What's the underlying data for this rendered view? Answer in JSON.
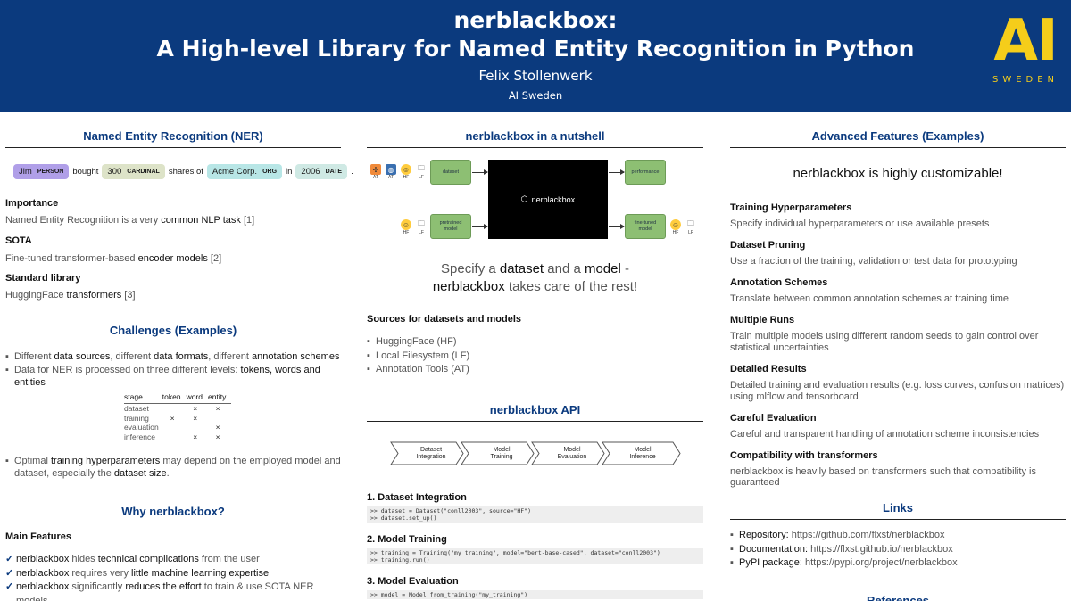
{
  "header": {
    "title_line1": "nerblackbox:",
    "title_line2": "A High-level Library for Named Entity Recognition in Python",
    "author": "Felix Stollenwerk",
    "affiliation": "AI Sweden",
    "logo_text": "AI",
    "logo_sub": "SWEDEN"
  },
  "col1": {
    "ner_title": "Named Entity Recognition (NER)",
    "ner_example": {
      "e1": "Jim",
      "e1_label": "PERSON",
      "w1": "bought",
      "e2": "300",
      "e2_label": "CARDINAL",
      "w2": "shares of",
      "e3": "Acme Corp.",
      "e3_label": "ORG",
      "w3": "in",
      "e4": "2006",
      "e4_label": "DATE",
      "w4": "."
    },
    "importance_title": "Importance",
    "importance_a": "Named Entity Recognition is a very ",
    "importance_b": "common NLP task",
    "importance_c": " [1]",
    "sota_title": "SOTA",
    "sota_a": "Fine-tuned transformer-based ",
    "sota_b": "encoder models",
    "sota_c": " [2]",
    "stdlib_title": "Standard library",
    "stdlib_a": "HuggingFace ",
    "stdlib_b": "transformers",
    "stdlib_c": " [3]",
    "challenges_title": "Challenges (Examples)",
    "ch1_a": "Different ",
    "ch1_b": "data sources",
    "ch1_c": ", different ",
    "ch1_d": "data formats",
    "ch1_e": ", different ",
    "ch1_f": "annotation schemes",
    "ch2_a": "Data for NER is processed on three different levels: ",
    "ch2_b": "tokens, words and entities",
    "table": {
      "headers": [
        "stage",
        "token",
        "word",
        "entity"
      ],
      "rows": [
        [
          "dataset",
          "",
          "×",
          "×"
        ],
        [
          "training",
          "×",
          "×",
          ""
        ],
        [
          "evaluation",
          "",
          "",
          "×"
        ],
        [
          "inference",
          "",
          "×",
          "×"
        ]
      ]
    },
    "ch3_a": "Optimal ",
    "ch3_b": "training hyperparameters",
    "ch3_c": " may depend on the employed model and dataset, especially the ",
    "ch3_d": "dataset size",
    "ch3_e": ".",
    "why_title": "Why nerblackbox?",
    "main_features": "Main Features",
    "f1_a": "nerblackbox",
    "f1_b": " hides ",
    "f1_c": "technical complications",
    "f1_d": " from the user",
    "f2_a": "nerblackbox",
    "f2_b": " requires very ",
    "f2_c": "little machine learning expertise",
    "f3_a": "nerblackbox",
    "f3_b": " significantly ",
    "f3_c": "reduces the effort",
    "f3_d": " to train & use SOTA NER models"
  },
  "col2": {
    "nutshell_title": "nerblackbox in a nutshell",
    "diagram": {
      "dataset": "dataset",
      "pretrained": "pretrained\nmodel",
      "performance": "performance",
      "finetuned": "fine-tuned\nmodel",
      "blackbox": "nerblackbox",
      "icons_top": [
        "AT",
        "AT",
        "HF",
        "LF"
      ],
      "icons_bl": [
        "HF",
        "LF"
      ],
      "icons_br": [
        "HF",
        "LF"
      ]
    },
    "tag_a": "Specify a ",
    "tag_b": "dataset",
    "tag_c": " and a ",
    "tag_d": "model",
    "tag_e": " -",
    "tag_f": "nerblackbox",
    "tag_g": " takes care of the rest!",
    "sources_title": "Sources for datasets and models",
    "sources": [
      "HuggingFace (HF)",
      "Local Filesystem (LF)",
      "Annotation Tools (AT)"
    ],
    "api_title": "nerblackbox API",
    "pipeline": [
      "Dataset\nIntegration",
      "Model\nTraining",
      "Model\nEvaluation",
      "Model\nInference"
    ],
    "step1_title": "1. Dataset Integration",
    "step1_code": ">> dataset = Dataset(\"conll2003\", source=\"HF\")\n>> dataset.set_up()",
    "step2_title": "2. Model Training",
    "step2_code": ">> training = Training(\"my_training\", model=\"bert-base-cased\", dataset=\"conll2003\")\n>> training.run()",
    "step3_title": "3. Model Evaluation",
    "step3_code": ">> model = Model.from_training(\"my_training\")"
  },
  "col3": {
    "adv_title": "Advanced Features (Examples)",
    "tagline": "nerblackbox is highly customizable!",
    "features": [
      {
        "title": "Training Hyperparameters",
        "text": "Specify individual hyperparameters or use available presets"
      },
      {
        "title": "Dataset Pruning",
        "text": "Use a fraction of the training, validation or test data for prototyping"
      },
      {
        "title": "Annotation Schemes",
        "text": "Translate between common annotation schemes at training time"
      },
      {
        "title": "Multiple Runs",
        "text": "Train multiple models using different random seeds to gain control over statistical uncertainties"
      },
      {
        "title": "Detailed Results",
        "text": "Detailed training and evaluation results (e.g. loss curves, confusion matrices) using mlflow and tensorboard"
      },
      {
        "title": "Careful Evaluation",
        "text": "Careful and transparent handling of annotation scheme inconsistencies"
      },
      {
        "title": "Compatibility with transformers",
        "text": "nerblackbox is heavily based on transformers such that compatibility is guaranteed"
      }
    ],
    "links_title": "Links",
    "links": [
      {
        "label": "Repository:",
        "url": "https://github.com/flxst/nerblackbox"
      },
      {
        "label": "Documentation:",
        "url": "https://flxst.github.io/nerblackbox"
      },
      {
        "label": "PyPI package:",
        "url": "https://pypi.org/project/nerblackbox"
      }
    ],
    "references_title": "References"
  }
}
